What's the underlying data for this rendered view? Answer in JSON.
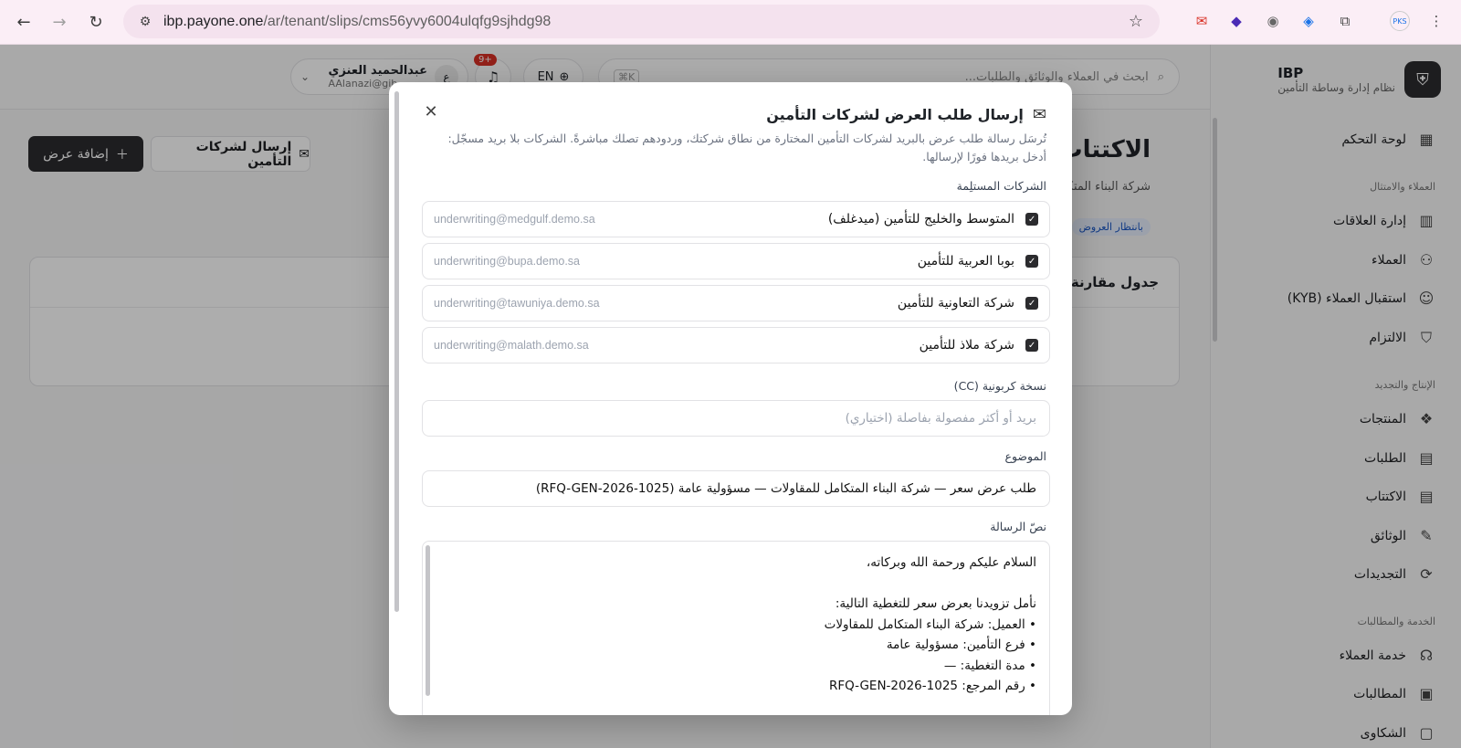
{
  "browser": {
    "url_host": "ibp.payone.one",
    "url_path": "/ar/tenant/slips/cms56yvy6004ulqfg9sjhdg98",
    "ext_label": "PKS"
  },
  "brand": {
    "name": "IBP",
    "subtitle": "نظام إدارة وساطة التأمين"
  },
  "sidebar": {
    "dashboard": "لوحة التحكم",
    "section_clients": "العملاء والامتثال",
    "relations": "إدارة العلاقات",
    "clients": "العملاء",
    "kyb": "استقبال العملاء (KYB)",
    "compliance": "الالتزام",
    "section_production": "الإنتاج والتجديد",
    "products": "المنتجات",
    "requests": "الطلبات",
    "underwriting": "الاكتتاب",
    "policies": "الوثائق",
    "renewals": "التجديدات",
    "section_service": "الخدمة والمطالبات",
    "customer_service": "خدمة العملاء",
    "claims": "المطالبات",
    "complaints": "الشكاوى"
  },
  "topbar": {
    "search_placeholder": "ابحث في العملاء والوثائق والطلبات...",
    "search_kbd": "K⌘",
    "lang": "EN",
    "notif_count": "9+",
    "user_name": "عبدالحميد العنزي",
    "user_email": "AAlanazi@gib-",
    "user_initial": "ع"
  },
  "page": {
    "title": "الاكتتاب الف",
    "subtitle": "شركة البناء المتكامل لل",
    "status": "بانتظار العروض",
    "add_offer": "إضافة عرض",
    "send_insurers": "إرسال لشركات التأمين",
    "card_title": "جدول مقارنة الع"
  },
  "modal": {
    "title": "إرسال طلب العرض لشركات التأمين",
    "description": "تُرسَل رسالة طلب عرض بالبريد لشركات التأمين المختارة من نطاق شركتك، وردودهم تصلك مباشرةً. الشركات بلا بريد مسجّل: أدخل بريدها فورًا لإرسالها.",
    "recipients_label": "الشركات المستلِمة",
    "recipients": [
      {
        "name": "المتوسط والخليج للتأمين (ميدغلف)",
        "email": "underwriting@medgulf.demo.sa"
      },
      {
        "name": "بوبا العربية للتأمين",
        "email": "underwriting@bupa.demo.sa"
      },
      {
        "name": "شركة التعاونية للتأمين",
        "email": "underwriting@tawuniya.demo.sa"
      },
      {
        "name": "شركة ملاذ للتأمين",
        "email": "underwriting@malath.demo.sa"
      }
    ],
    "cc_label": "نسخة كربونية (CC)",
    "cc_placeholder": "بريد أو أكثر مفصولة بفاصلة (اختياري)",
    "subject_label": "الموضوع",
    "subject_value": "طلب عرض سعر — شركة البناء المتكامل للمقاولات — مسؤولية عامة (RFQ-GEN-2026-1025)",
    "body_label": "نصّ الرسالة",
    "body_lines": [
      "السلام عليكم ورحمة الله وبركاته،",
      "",
      "نأمل تزويدنا بعرض سعر للتغطية التالية:",
      "• العميل: شركة البناء المتكامل للمقاولات",
      "• فرع التأمين: مسؤولية عامة",
      "• مدة التغطية: —",
      "• رقم المرجع: RFQ-GEN-2026-1025"
    ]
  }
}
